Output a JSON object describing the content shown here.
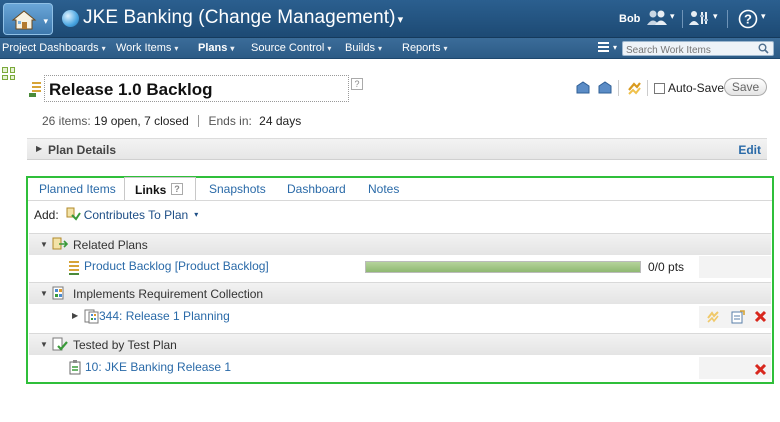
{
  "banner": {
    "title": "JKE Banking (Change Management)",
    "user": "Bob",
    "icons": [
      "home-icon",
      "project-globe-icon",
      "people-icon",
      "settings-icon",
      "help-icon"
    ]
  },
  "nav": {
    "items": [
      {
        "label": "Project Dashboards",
        "active": false
      },
      {
        "label": "Work Items",
        "active": false
      },
      {
        "label": "Plans",
        "active": true
      },
      {
        "label": "Source Control",
        "active": false
      },
      {
        "label": "Builds",
        "active": false
      },
      {
        "label": "Reports",
        "active": false
      }
    ],
    "search_placeholder": "Search Work Items"
  },
  "plan": {
    "name": "Release 1.0 Backlog",
    "summary": {
      "items": "26 items:",
      "open_closed": "19 open, 7 closed",
      "ends_label": "Ends in:",
      "ends_value": "24 days"
    },
    "autosave_label": "Auto-Save",
    "save_label": "Save",
    "details_label": "Plan Details",
    "edit_label": "Edit"
  },
  "tabs": [
    "Planned Items",
    "Links",
    "Snapshots",
    "Dashboard",
    "Notes"
  ],
  "active_tab": "Links",
  "links": {
    "add_label": "Add:",
    "add_link": "Contributes To Plan",
    "groups": [
      {
        "label": "Related Plans",
        "rows": [
          {
            "text": "Product Backlog [Product Backlog]",
            "progress": 0.0,
            "pts": "0/0 pts"
          }
        ]
      },
      {
        "label": "Implements Requirement Collection",
        "rows": [
          {
            "text": "344: Release 1 Planning"
          }
        ]
      },
      {
        "label": "Tested by Test Plan",
        "rows": [
          {
            "text": "10: JKE Banking Release 1"
          }
        ]
      }
    ]
  },
  "colors": {
    "banner": "#1d4a74",
    "nav": "#2c5b86",
    "link": "#2a6aa8",
    "panel_border": "#2fbf3a",
    "progress_fill": "#8fb872",
    "remove": "#d8281e"
  }
}
